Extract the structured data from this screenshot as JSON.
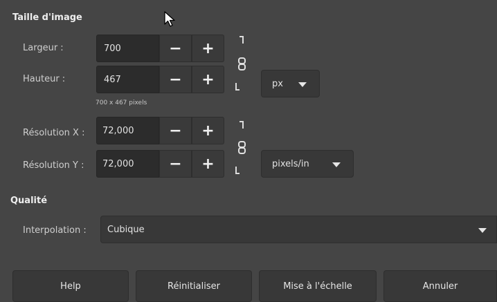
{
  "sections": {
    "image_size": "Taille d'image",
    "quality": "Qualité"
  },
  "width": {
    "label": "Largeur :",
    "value": "700"
  },
  "height": {
    "label": "Hauteur :",
    "value": "467"
  },
  "size_hint": "700 x 467 pixels",
  "size_unit": "px",
  "res_x": {
    "label": "Résolution X :",
    "value": "72,000"
  },
  "res_y": {
    "label": "Résolution Y :",
    "value": "72,000"
  },
  "res_unit": "pixels/in",
  "interpolation": {
    "label": "Interpolation :",
    "value": "Cubique"
  },
  "buttons": {
    "help": "Help",
    "reset": "Réinitialiser",
    "scale": "Mise à l'échelle",
    "cancel": "Annuler"
  },
  "glyphs": {
    "minus": "−",
    "plus": "+"
  },
  "icons": [
    "chain-link-icon",
    "dropdown-arrow-icon",
    "mouse-cursor-icon"
  ],
  "colors": {
    "background": "#454545",
    "field": "#2c2c2c",
    "button": "#383838",
    "text": "#dcdcdc"
  }
}
